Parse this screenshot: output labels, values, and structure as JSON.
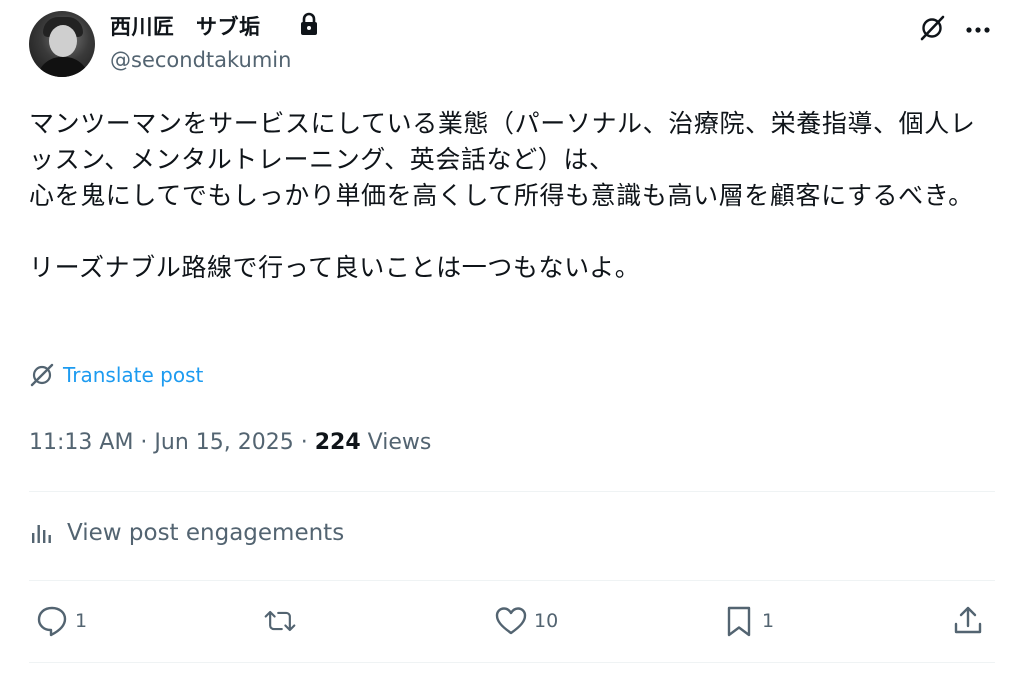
{
  "author": {
    "display_name": "西川匠　サブ垢",
    "handle": "@secondtakumin"
  },
  "tweet": {
    "text": "マンツーマンをサービスにしている業態（パーソナル、治療院、栄養指導、個人レッスン、メンタルトレーニング、英会話など）は、\n心を鬼にしてでもしっかり単価を高くして所得も意識も高い層を顧客にするべき。\n\nリーズナブル路線で行って良いことは一つもないよ。",
    "translate_label": "Translate post",
    "timestamp": "11:13 AM · Jun 15, 2025 · ",
    "views_count": "224",
    "views_label": " Views"
  },
  "engagements_label": "View post engagements",
  "actions": {
    "reply_count": "1",
    "repost_count": "",
    "like_count": "10",
    "bookmark_count": "1"
  },
  "icons": {
    "lock": "lock-icon",
    "grok": "grok-icon",
    "more": "more-icon",
    "translate": "translate-icon",
    "engagements": "bar-chart-icon",
    "reply": "reply-icon",
    "repost": "repost-icon",
    "like": "heart-icon",
    "bookmark": "bookmark-icon",
    "share": "share-icon"
  },
  "colors": {
    "link": "#1d9bf0",
    "secondary_text": "#536471",
    "primary_text": "#0f1419"
  }
}
